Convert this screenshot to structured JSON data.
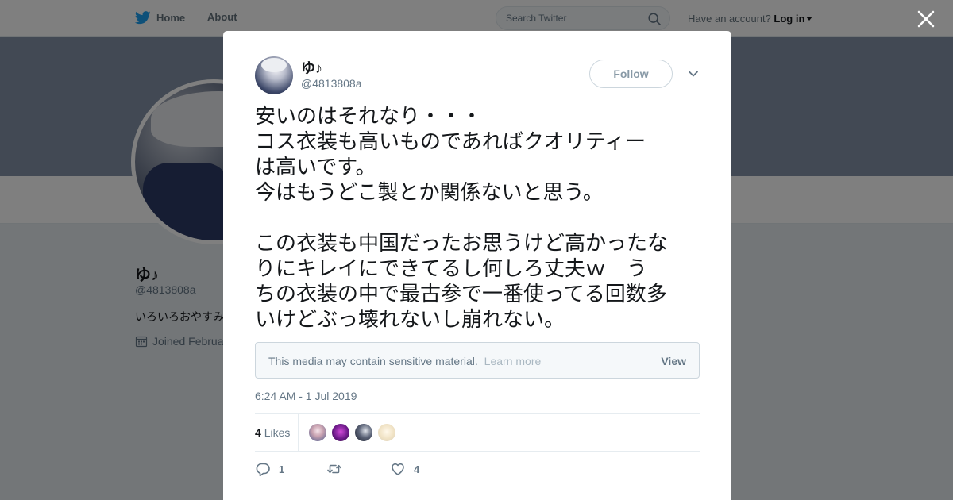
{
  "topbar": {
    "home_label": "Home",
    "about_label": "About",
    "search_placeholder": "Search Twitter",
    "account_prompt": "Have an account?",
    "login_label": "Log in"
  },
  "profile": {
    "name": "ゆ♪",
    "handle": "@4813808a",
    "bio": "いろいろおやすみ",
    "joined": "Joined Februa"
  },
  "tweet": {
    "display_name": "ゆ♪",
    "handle": "@4813808a",
    "follow_label": "Follow",
    "text_lines": [
      "安いのはそれなり・・・",
      "コス衣装も高いものであればクオリティー",
      "は高いです。",
      "今はもうどこ製とか関係ないと思う。",
      "",
      "この衣装も中国だったお思うけど高かったな",
      "りにキレイにできてるし何しろ丈夫ｗ　う",
      "ちの衣装の中で最古参で一番使ってる回数多",
      "いけどぶっ壊れないし崩れない。"
    ],
    "sensitive_notice": "This media may contain sensitive material.",
    "learn_more": "Learn more",
    "view_label": "View",
    "timestamp": "6:24 AM - 1 Jul 2019",
    "likes_count": "4",
    "likes_label": "Likes",
    "reply_count": "1",
    "retweet_count": "",
    "like_count": "4"
  },
  "colors": {
    "twitter_blue": "#1da1f2",
    "banner": "#8493a9",
    "muted_text": "#657786"
  },
  "icons": [
    "twitter-bird-icon",
    "search-icon",
    "close-icon",
    "chevron-down-icon",
    "calendar-icon",
    "reply-icon",
    "retweet-icon",
    "heart-icon"
  ]
}
